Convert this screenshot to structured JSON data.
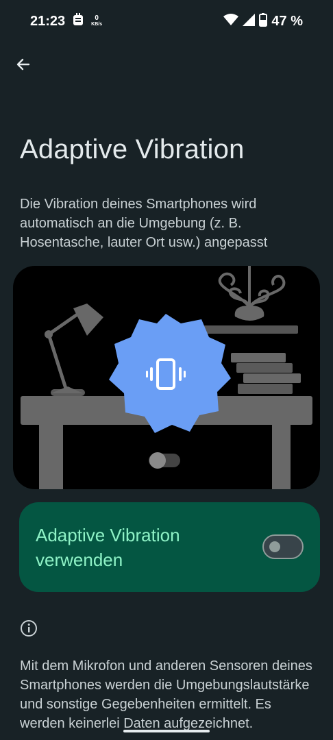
{
  "status_bar": {
    "time": "21:23",
    "network_speed_value": "0",
    "network_speed_unit": "KB/s",
    "battery_percent": "47 %"
  },
  "header": {
    "back_icon": "arrow-back-icon",
    "title": "Adaptive Vibration"
  },
  "description": "Die Vibration deines Smartphones wird automatisch an die Umgebung (z. B. Hosentasche, lauter Ort usw.) angepasst",
  "toggle": {
    "label": "Adaptive Vibration verwenden",
    "checked": false
  },
  "footer": {
    "info_icon": "info-icon",
    "text": "Mit dem Mikrofon und anderen Sensoren deines Smartphones werden die Umgebungslautstärke und sonstige Gegebenheiten ermittelt. Es werden keinerlei Daten aufgezeichnet."
  },
  "colors": {
    "background": "#182226",
    "card": "#045642",
    "card_text": "#8ef2c6",
    "burst": "#6a9ef5"
  }
}
